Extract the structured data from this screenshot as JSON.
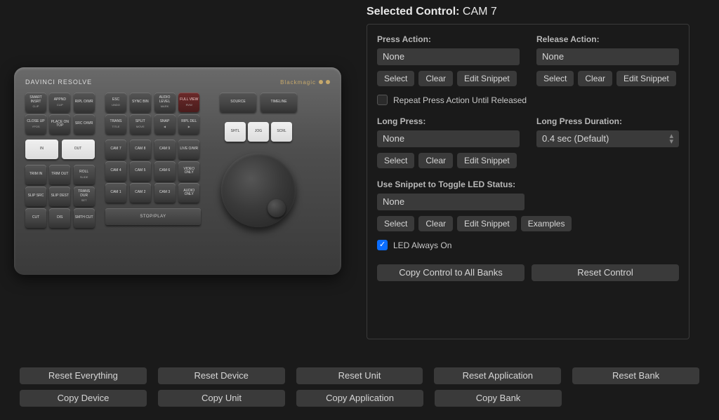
{
  "header": {
    "title_prefix": "Selected Control:",
    "control_name": "CAM 7"
  },
  "press": {
    "label": "Press Action:",
    "value": "None",
    "select": "Select",
    "clear": "Clear",
    "edit": "Edit Snippet"
  },
  "release": {
    "label": "Release Action:",
    "value": "None",
    "select": "Select",
    "clear": "Clear",
    "edit": "Edit Snippet"
  },
  "repeat_label": "Repeat Press Action Until Released",
  "longpress": {
    "label": "Long Press:",
    "value": "None",
    "select": "Select",
    "clear": "Clear",
    "edit": "Edit Snippet"
  },
  "duration": {
    "label": "Long Press Duration:",
    "value": "0.4 sec (Default)"
  },
  "led": {
    "label": "Use Snippet to Toggle LED Status:",
    "value": "None",
    "select": "Select",
    "clear": "Clear",
    "edit": "Edit Snippet",
    "examples": "Examples",
    "always_on": "LED Always On"
  },
  "big_buttons": {
    "copy_all": "Copy Control to All Banks",
    "reset_control": "Reset Control"
  },
  "bottom_row1": [
    "Reset Everything",
    "Reset Device",
    "Reset Unit",
    "Reset Application",
    "Reset Bank"
  ],
  "bottom_row2": [
    "Copy Device",
    "Copy Unit",
    "Copy Application",
    "Copy Bank"
  ],
  "hw": {
    "brand": "DAVINCI RESOLVE",
    "maker": "Blackmagic",
    "top_left": [
      {
        "t": "SMART INSRT",
        "s": "CLIP"
      },
      {
        "t": "APPND",
        "s": "CLIP"
      },
      {
        "t": "RIPL O/WR",
        "s": ""
      },
      {
        "t": "CLOSE UP",
        "s": "YPOS"
      },
      {
        "t": "PLACE ON TOP",
        "s": ""
      },
      {
        "t": "SRC O/WR",
        "s": ""
      }
    ],
    "in_out": [
      {
        "t": "IN",
        "s": ""
      },
      {
        "t": "OUT",
        "s": ""
      }
    ],
    "trim": [
      {
        "t": "TRIM IN",
        "s": ""
      },
      {
        "t": "TRIM OUT",
        "s": ""
      },
      {
        "t": "ROLL",
        "s": "SLIDE"
      },
      {
        "t": "SLIP SRC",
        "s": ""
      },
      {
        "t": "SLIP DEST",
        "s": ""
      },
      {
        "t": "TRANS DUR",
        "s": "SET"
      },
      {
        "t": "CUT",
        "s": ""
      },
      {
        "t": "DIS",
        "s": ""
      },
      {
        "t": "SMTH CUT",
        "s": ""
      }
    ],
    "center_top": [
      {
        "t": "ESC",
        "s": "UNDO"
      },
      {
        "t": "SYNC BIN",
        "s": ""
      },
      {
        "t": "AUDIO LEVEL",
        "s": "MARK"
      },
      {
        "t": "FULL VIEW",
        "s": "RVW",
        "cls": "red"
      },
      {
        "t": "TRANS",
        "s": "TITLE"
      },
      {
        "t": "SPLIT",
        "s": "MOVE"
      },
      {
        "t": "SNAP",
        "s": "◀"
      },
      {
        "t": "RIPL DEL",
        "s": "▶"
      }
    ],
    "cams": [
      {
        "t": "CAM 7",
        "s": ""
      },
      {
        "t": "CAM 8",
        "s": ""
      },
      {
        "t": "CAM 9",
        "s": ""
      },
      {
        "t": "LIVE O/WR",
        "s": ""
      },
      {
        "t": "CAM 4",
        "s": ""
      },
      {
        "t": "CAM 5",
        "s": ""
      },
      {
        "t": "CAM 6",
        "s": ""
      },
      {
        "t": "VIDEO ONLY",
        "s": ""
      },
      {
        "t": "CAM 1",
        "s": ""
      },
      {
        "t": "CAM 2",
        "s": ""
      },
      {
        "t": "CAM 3",
        "s": ""
      },
      {
        "t": "AUDIO ONLY",
        "s": ""
      }
    ],
    "play": "STOP/PLAY",
    "right_top": [
      {
        "t": "SOURCE",
        "s": ""
      },
      {
        "t": "TIMELINE",
        "s": ""
      }
    ],
    "right_mode": [
      {
        "t": "SHTL",
        "s": "",
        "cls": "white"
      },
      {
        "t": "JOG",
        "s": "",
        "cls": "white"
      },
      {
        "t": "SCRL",
        "s": "",
        "cls": "white"
      }
    ]
  }
}
